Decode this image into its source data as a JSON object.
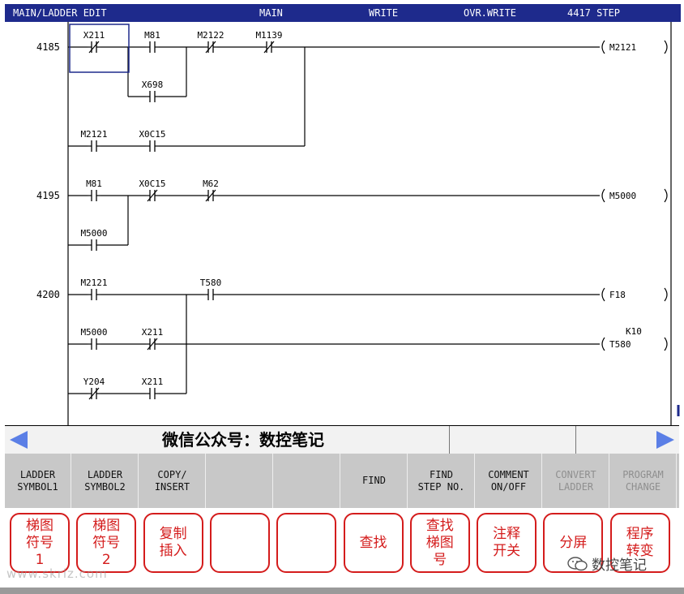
{
  "header": {
    "mode": "MAIN/LADDER EDIT",
    "program": "MAIN",
    "write_mode": "WRITE",
    "overwrite": "OVR.WRITE",
    "step_count": "4417 STEP"
  },
  "ladder": {
    "rung_steps": [
      "4185",
      "4195",
      "4200"
    ],
    "contacts": [
      {
        "label": "X211",
        "type": "nc"
      },
      {
        "label": "M81",
        "type": "no"
      },
      {
        "label": "M2122",
        "type": "nc"
      },
      {
        "label": "M1139",
        "type": "nc"
      },
      {
        "label": "X698",
        "type": "no"
      },
      {
        "label": "M2121",
        "type": "no"
      },
      {
        "label": "X0C15",
        "type": "no"
      },
      {
        "label": "M81",
        "type": "no"
      },
      {
        "label": "X0C15",
        "type": "nc"
      },
      {
        "label": "M62",
        "type": "nc"
      },
      {
        "label": "M5000",
        "type": "no"
      },
      {
        "label": "M2121",
        "type": "no"
      },
      {
        "label": "T580",
        "type": "no"
      },
      {
        "label": "M5000",
        "type": "no"
      },
      {
        "label": "X211",
        "type": "nc"
      },
      {
        "label": "Y204",
        "type": "nc"
      },
      {
        "label": "X211",
        "type": "no"
      }
    ],
    "coils": [
      {
        "label": "M2121",
        "constant": ""
      },
      {
        "label": "M5000",
        "constant": ""
      },
      {
        "label": "F18",
        "constant": ""
      },
      {
        "label": "T580",
        "constant": "K10"
      }
    ]
  },
  "status_bar": {
    "message": "微信公众号：数控笔记",
    "nav_left": "left-arrow-icon",
    "nav_right": "right-arrow-icon"
  },
  "function_keys": [
    {
      "label": "LADDER\nSYMBOL1",
      "enabled": true
    },
    {
      "label": "LADDER\nSYMBOL2",
      "enabled": true
    },
    {
      "label": "COPY/\nINSERT",
      "enabled": true
    },
    {
      "label": "",
      "enabled": true
    },
    {
      "label": "",
      "enabled": true
    },
    {
      "label": "FIND",
      "enabled": true
    },
    {
      "label": "FIND\nSTEP NO.",
      "enabled": true
    },
    {
      "label": "COMMENT\nON/OFF",
      "enabled": true
    },
    {
      "label": "CONVERT\nLADDER",
      "enabled": false
    },
    {
      "label": "PROGRAM\nCHANGE",
      "enabled": false
    }
  ],
  "chinese_labels": [
    "梯图\n符号\n1",
    "梯图\n符号\n2",
    "复制\n插入",
    "",
    "",
    "查找",
    "查找\n梯图\n号",
    "注释\n开关",
    "分屏",
    "程序\n转变"
  ],
  "watermarks": {
    "site": "www.skrlz.com",
    "account": "数控笔记"
  },
  "colors": {
    "header_bg": "#1e2a8c",
    "nav_arrow": "#5b7fe6",
    "annotation_red": "#d41c1c",
    "fkey_bg": "#c8c8c8"
  }
}
